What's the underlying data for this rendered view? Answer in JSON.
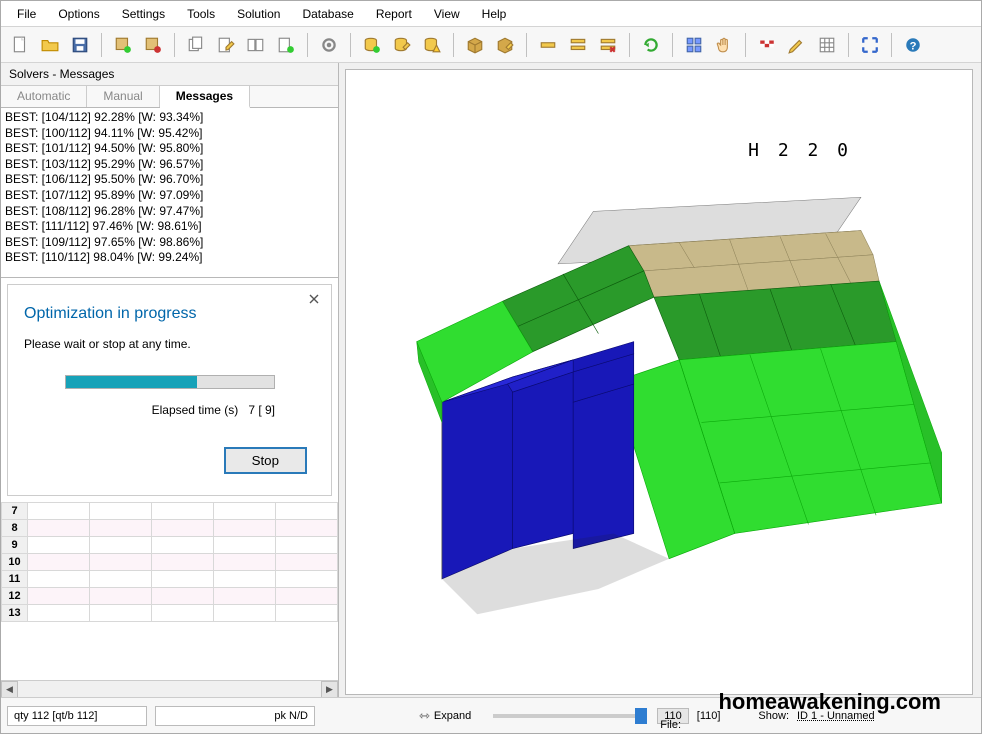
{
  "menu": {
    "items": [
      "File",
      "Options",
      "Settings",
      "Tools",
      "Solution",
      "Database",
      "Report",
      "View",
      "Help"
    ]
  },
  "toolbar_icons": [
    "new-file-icon",
    "open-folder-icon",
    "save-icon",
    "sep",
    "prop-add-icon",
    "prop-remove-icon",
    "sep",
    "copy-icon",
    "edit-page-icon",
    "multi-page-icon",
    "page-go-icon",
    "sep",
    "gear-icon",
    "sep",
    "db-go-icon",
    "db-edit-icon",
    "db-warn-icon",
    "sep",
    "package-icon",
    "pkg-edit-icon",
    "sep",
    "row-icon",
    "rows-icon",
    "rows-del-icon",
    "sep",
    "refresh-icon",
    "sep",
    "align-icon",
    "hand-icon",
    "sep",
    "flag-icon",
    "pencil-icon",
    "grid-icon",
    "sep",
    "expand-arrows-icon",
    "sep",
    "help-icon"
  ],
  "solvers": {
    "panel_title": "Solvers - Messages",
    "tabs": [
      "Automatic",
      "Manual",
      "Messages"
    ],
    "active_tab": 2,
    "messages": [
      "BEST: [104/112] 92.28% [W: 93.34%]",
      "BEST: [100/112] 94.11% [W: 95.42%]",
      "BEST: [101/112] 94.50% [W: 95.80%]",
      "BEST: [103/112] 95.29% [W: 96.57%]",
      "BEST: [106/112] 95.50% [W: 96.70%]",
      "BEST: [107/112] 95.89% [W: 97.09%]",
      "BEST: [108/112] 96.28% [W: 97.47%]",
      "BEST: [111/112] 97.46% [W: 98.61%]",
      "BEST: [109/112] 97.65% [W: 98.86%]",
      "BEST: [110/112] 98.04% [W: 99.24%]"
    ]
  },
  "dialog": {
    "title": "Optimization in progress",
    "message": "Please wait or stop at any time.",
    "elapsed_label": "Elapsed time (s)",
    "elapsed_value": "7 [   9]",
    "stop_label": "Stop"
  },
  "grid_rows": [
    "7",
    "8",
    "9",
    "10",
    "11",
    "12",
    "13"
  ],
  "viewport": {
    "label": "H  2 2 0"
  },
  "status": {
    "qty": "qty 112 [qt/b 112]",
    "pk": "pk N/D",
    "expand": "Expand",
    "num1": "110",
    "num2": "[110]",
    "show_label": "Show:",
    "show_value": "ID 1 - Unnamed",
    "file_label": "File:"
  },
  "watermark": "homeawakening.com"
}
